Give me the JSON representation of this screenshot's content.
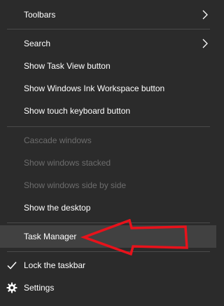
{
  "menu": {
    "toolbars": "Toolbars",
    "search": "Search",
    "show_task_view": "Show Task View button",
    "show_ink_workspace": "Show Windows Ink Workspace button",
    "show_touch_keyboard": "Show touch keyboard button",
    "cascade": "Cascade windows",
    "stacked": "Show windows stacked",
    "side_by_side": "Show windows side by side",
    "show_desktop": "Show the desktop",
    "task_manager": "Task Manager",
    "lock_taskbar": "Lock the taskbar",
    "settings": "Settings"
  },
  "state": {
    "lock_taskbar_checked": true,
    "highlighted_item": "Task Manager"
  },
  "icons": {
    "submenu": "chevron-right-icon",
    "check": "checkmark-icon",
    "settings": "gear-icon",
    "annotation": "red-arrow-icon"
  },
  "colors": {
    "background": "#2b2b2b",
    "hover": "#414141",
    "text": "#ffffff",
    "disabled_text": "#6d6d6d",
    "separator": "#4a4a4a",
    "annotation": "#e8121b"
  }
}
